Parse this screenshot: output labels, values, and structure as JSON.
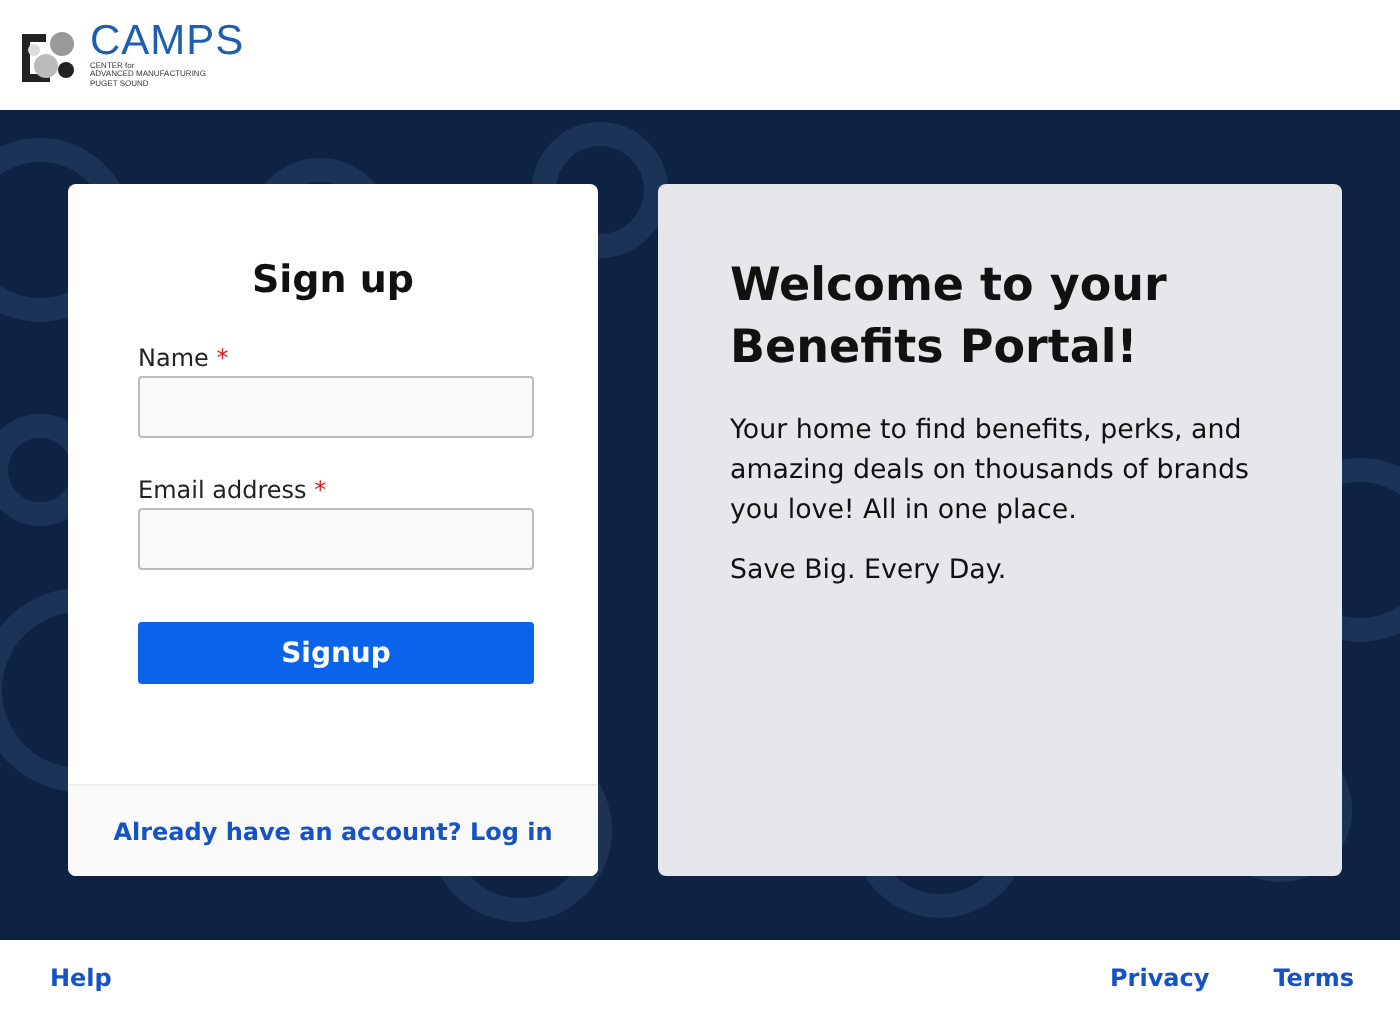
{
  "header": {
    "logo": {
      "name": "CAMPS",
      "lines": [
        "CENTER for",
        "ADVANCED MANUFACTURING",
        "PUGET SOUND"
      ]
    }
  },
  "signup": {
    "title": "Sign up",
    "fields": [
      {
        "label": "Name",
        "required_mark": "*"
      },
      {
        "label": "Email address",
        "required_mark": "*"
      }
    ],
    "button": "Signup",
    "login_link": "Already have an account? Log in"
  },
  "welcome": {
    "heading": "Welcome to your Benefits Portal!",
    "paragraphs": [
      "Your home to find benefits, perks, and amazing deals on thousands of brands you love! All in one place.",
      "Save Big. Every Day."
    ]
  },
  "footer": {
    "left_links": [
      "Help"
    ],
    "right_links": [
      "Privacy",
      "Terms"
    ]
  }
}
